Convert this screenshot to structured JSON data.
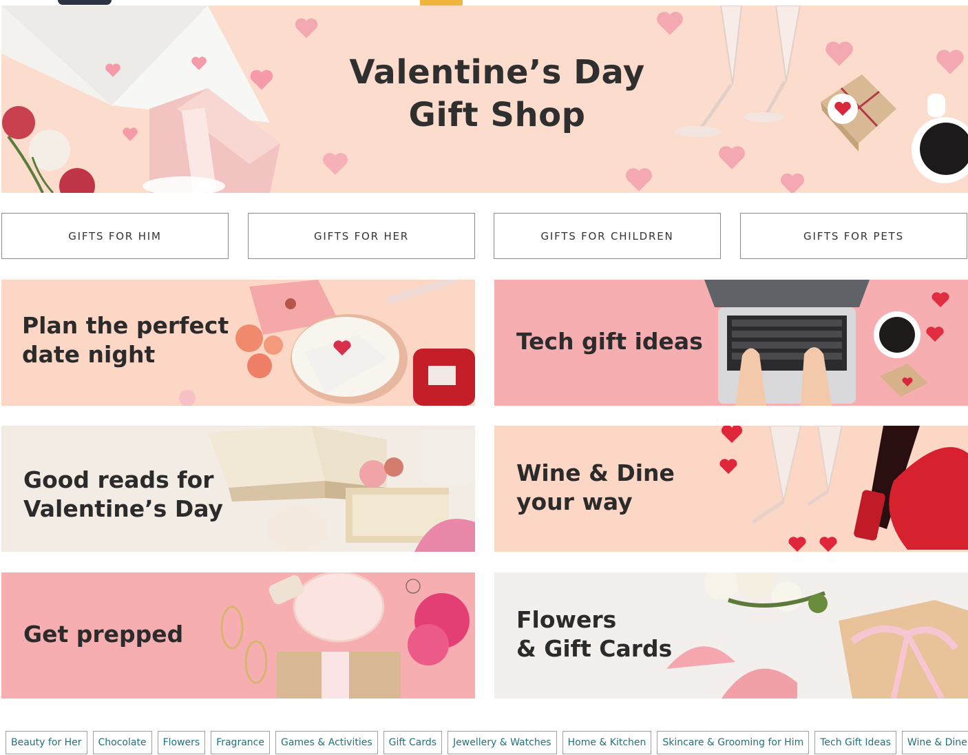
{
  "hero": {
    "title_line1": "Valentine’s Day",
    "title_line2": "Gift Shop"
  },
  "categories": [
    {
      "label": "GIFTS FOR HIM"
    },
    {
      "label": "GIFTS FOR HER"
    },
    {
      "label": "GIFTS FOR CHILDREN"
    },
    {
      "label": "GIFTS FOR PETS"
    }
  ],
  "tiles": [
    {
      "label": "Plan the perfect\ndate night"
    },
    {
      "label": "Tech gift ideas"
    },
    {
      "label": "Good reads for\nValentine’s Day"
    },
    {
      "label": "Wine & Dine\nyour way"
    },
    {
      "label": "Get prepped"
    },
    {
      "label": "Flowers\n& Gift Cards"
    }
  ],
  "tags": [
    "Beauty for Her",
    "Chocolate",
    "Flowers",
    "Fragrance",
    "Games & Activities",
    "Gift Cards",
    "Jewellery & Watches",
    "Home & Kitchen",
    "Skincare & Grooming for Him",
    "Tech Gift Ideas",
    "Wine & Dine"
  ],
  "colors": {
    "hero_bg": "#fcdccd",
    "peach_tile": "#fcd7c6",
    "pink_tile": "#f6aeb1",
    "tag_text": "#236f7a"
  }
}
